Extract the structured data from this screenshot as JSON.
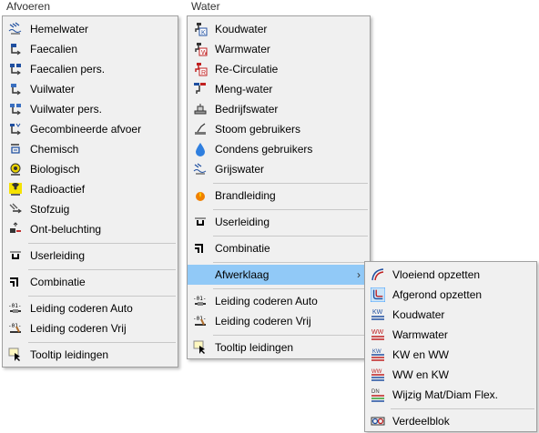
{
  "headers": {
    "afvoeren": "Afvoeren",
    "water": "Water"
  },
  "afvoeren": {
    "items": [
      {
        "label": "Hemelwater",
        "icon": "rain-icon"
      },
      {
        "label": "Faecalien",
        "icon": "faecal-icon"
      },
      {
        "label": "Faecalien pers.",
        "icon": "faecal-pressure-icon"
      },
      {
        "label": "Vuilwater",
        "icon": "waste-water-icon"
      },
      {
        "label": "Vuilwater pers.",
        "icon": "waste-water-pressure-icon"
      },
      {
        "label": "Gecombineerde afvoer",
        "icon": "combined-drain-icon"
      },
      {
        "label": "Chemisch",
        "icon": "chemical-icon"
      },
      {
        "label": "Biologisch",
        "icon": "biohazard-icon"
      },
      {
        "label": "Radioactief",
        "icon": "radioactive-icon"
      },
      {
        "label": "Stofzuig",
        "icon": "vacuum-icon"
      },
      {
        "label": "Ont-beluchting",
        "icon": "vent-icon"
      },
      {
        "label": "Userleiding",
        "icon": "user-pipe-icon"
      },
      {
        "label": "Combinatie",
        "icon": "combination-icon"
      },
      {
        "label": "Leiding coderen Auto",
        "icon": "code-auto-icon"
      },
      {
        "label": "Leiding coderen Vrij",
        "icon": "code-free-icon"
      },
      {
        "label": "Tooltip leidingen",
        "icon": "tooltip-icon"
      }
    ]
  },
  "water": {
    "items": [
      {
        "label": "Koudwater",
        "icon": "cold-water-tap-icon"
      },
      {
        "label": "Warmwater",
        "icon": "hot-water-tap-icon"
      },
      {
        "label": "Re-Circulatie",
        "icon": "recirculation-icon"
      },
      {
        "label": "Meng-water",
        "icon": "mixed-water-icon"
      },
      {
        "label": "Bedrijfswater",
        "icon": "process-water-icon"
      },
      {
        "label": "Stoom   gebruikers",
        "icon": "steam-icon"
      },
      {
        "label": "Condens gebruikers",
        "icon": "condensate-drop-icon"
      },
      {
        "label": "Grijswater",
        "icon": "grey-water-icon"
      },
      {
        "label": "Brandleiding",
        "icon": "fire-pipe-icon"
      },
      {
        "label": "Userleiding",
        "icon": "user-pipe-icon"
      },
      {
        "label": "Combinatie",
        "icon": "combination-icon"
      },
      {
        "label": "Afwerklaag",
        "icon": "",
        "submenu": true
      },
      {
        "label": "Leiding coderen Auto",
        "icon": "code-auto-icon"
      },
      {
        "label": "Leiding coderen Vrij",
        "icon": "code-free-icon"
      },
      {
        "label": "Tooltip leidingen",
        "icon": "tooltip-icon"
      }
    ]
  },
  "afwerklaag": {
    "items": [
      {
        "label": "Vloeiend opzetten",
        "icon": "smooth-bend-icon"
      },
      {
        "label": "Afgerond opzetten",
        "icon": "rounded-bend-icon"
      },
      {
        "label": "Koudwater",
        "icon": "kw-label-icon"
      },
      {
        "label": "Warmwater",
        "icon": "ww-label-icon"
      },
      {
        "label": "KW en WW",
        "icon": "kw-ww-icon"
      },
      {
        "label": "WW en KW",
        "icon": "ww-kw-icon"
      },
      {
        "label": "Wijzig Mat/Diam Flex.",
        "icon": "change-material-icon"
      },
      {
        "label": "Verdeelblok",
        "icon": "manifold-icon"
      }
    ]
  },
  "colors": {
    "highlight": "#91c9f7",
    "menu_bg": "#f0f0f0",
    "border": "#a0a0a0"
  }
}
